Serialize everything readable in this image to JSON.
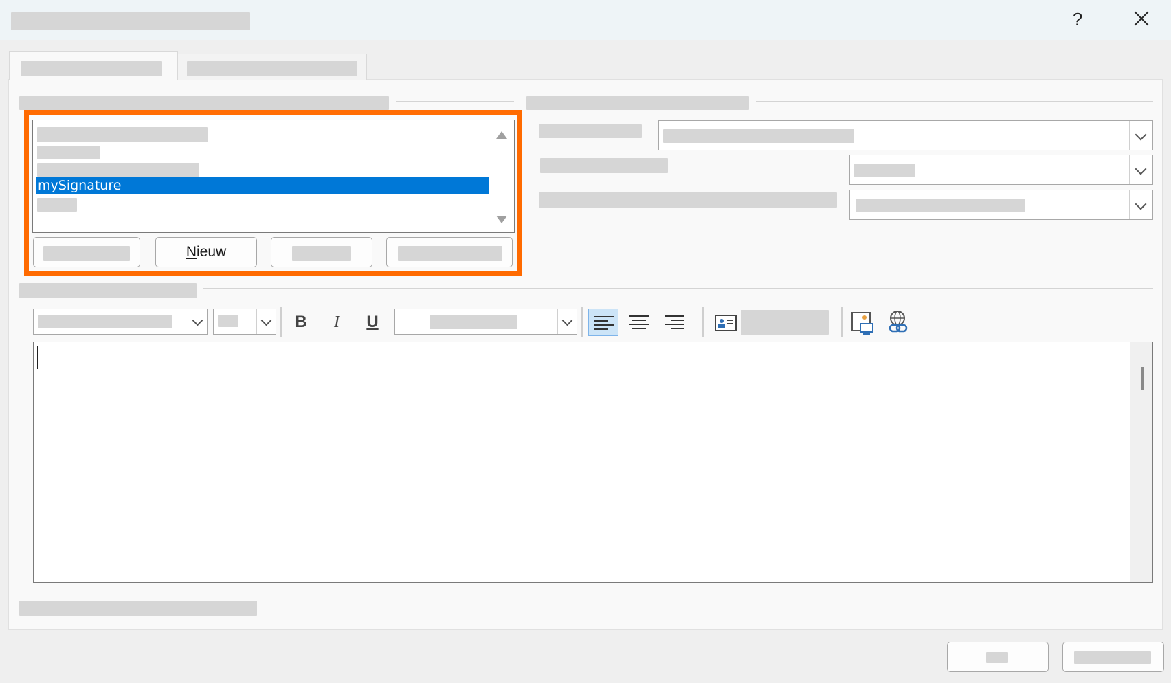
{
  "window": {
    "title": "",
    "help_label": "?",
    "close_label": "close"
  },
  "tabs": [
    {
      "label": ""
    },
    {
      "label": ""
    }
  ],
  "signatures": {
    "section_label": "",
    "items": [
      {
        "label": "",
        "selected": false
      },
      {
        "label": "",
        "selected": false
      },
      {
        "label": "",
        "selected": false
      },
      {
        "label": "mySignature",
        "selected": true
      },
      {
        "label": "",
        "selected": false
      }
    ],
    "buttons": {
      "delete": "",
      "new_prefix": "N",
      "new_rest": "ieuw",
      "save": "",
      "rename": ""
    }
  },
  "defaults": {
    "section_label": "",
    "account_label": "",
    "account_value": "",
    "new_messages_label": "",
    "new_messages_value": "",
    "replies_label": "",
    "replies_value": ""
  },
  "editor": {
    "section_label": "",
    "font_value": "",
    "size_value": "",
    "color_value": "",
    "business_card_label": "",
    "content": ""
  },
  "footer": {
    "note": "",
    "ok_label": "",
    "cancel_label": ""
  },
  "colors": {
    "highlight": "#ff6a00",
    "selection": "#0078d7"
  }
}
